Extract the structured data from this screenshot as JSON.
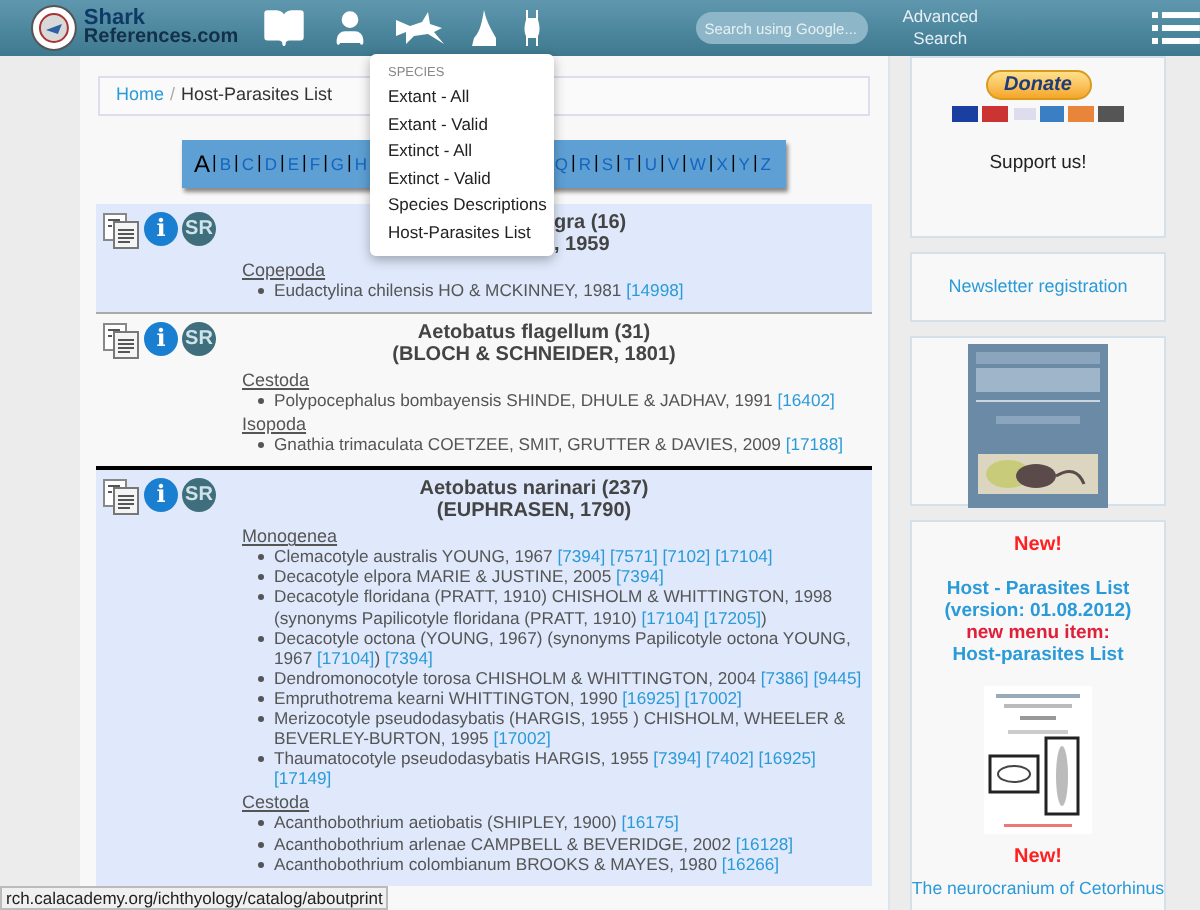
{
  "header": {
    "logo_top": "Shark",
    "logo_bottom": "References.com",
    "search": {
      "placeholder": "Search using Google..."
    },
    "advanced_search": "Advanced Search"
  },
  "menu": {
    "heading": "SPECIES",
    "items": [
      "Extant - All",
      "Extant - Valid",
      "Extinct - All",
      "Extinct - Valid",
      "Species Descriptions",
      "Host-Parasites List"
    ]
  },
  "breadcrumb": {
    "separator": "/",
    "items": [
      {
        "label": "Home",
        "kind": "link"
      },
      {
        "label": "Host-Parasites List",
        "kind": "current"
      }
    ]
  },
  "alphabet": {
    "separator": "|",
    "before": [
      {
        "letter": "A",
        "selected": true
      },
      {
        "letter": "B",
        "selected": false
      },
      {
        "letter": "C",
        "selected": false
      },
      {
        "letter": "D",
        "selected": false
      },
      {
        "letter": "E",
        "selected": false
      },
      {
        "letter": "F",
        "selected": false
      },
      {
        "letter": "G",
        "selected": false
      },
      {
        "letter": "H",
        "selected": false
      }
    ],
    "after": [
      {
        "letter": "Q",
        "selected": false
      },
      {
        "letter": "R",
        "selected": false
      },
      {
        "letter": "S",
        "selected": false
      },
      {
        "letter": "T",
        "selected": false
      },
      {
        "letter": "U",
        "selected": false
      },
      {
        "letter": "V",
        "selected": false
      },
      {
        "letter": "W",
        "selected": false
      },
      {
        "letter": "X",
        "selected": false
      },
      {
        "letter": "Y",
        "selected": false
      },
      {
        "letter": "Z",
        "selected": false
      }
    ]
  },
  "entries": [
    {
      "host": "gra (16)",
      "authority": ", 1959",
      "highlighted": true,
      "covered_by_menu": true,
      "info_label": "i",
      "sr_label": "SR",
      "groups": [
        {
          "name": "Copepoda",
          "parasites": [
            [
              {
                "kind": "text",
                "text": "Eudactylina chilensis HO & MCKINNEY, 1981"
              },
              {
                "kind": "ref",
                "text": "[14998]"
              }
            ]
          ]
        }
      ]
    },
    {
      "host": "Aetobatus flagellum (31)",
      "authority": "(BLOCH & SCHNEIDER, 1801)",
      "highlighted": false,
      "covered_by_menu": false,
      "info_label": "i",
      "sr_label": "SR",
      "groups": [
        {
          "name": "Cestoda",
          "parasites": [
            [
              {
                "kind": "text",
                "text": "Polypocephalus bombayensis SHINDE, DHULE & JADHAV, 1991"
              },
              {
                "kind": "ref",
                "text": "[16402]"
              }
            ]
          ]
        },
        {
          "name": "Isopoda",
          "parasites": [
            [
              {
                "kind": "text",
                "text": "Gnathia trimaculata COETZEE, SMIT, GRUTTER & DAVIES, 2009"
              },
              {
                "kind": "ref",
                "text": "[17188]"
              }
            ]
          ]
        }
      ]
    },
    {
      "host": "Aetobatus narinari (237)",
      "authority": "(EUPHRASEN, 1790)",
      "highlighted": true,
      "covered_by_menu": false,
      "info_label": "i",
      "sr_label": "SR",
      "groups": [
        {
          "name": "Monogenea",
          "parasites": [
            [
              {
                "kind": "text",
                "text": "Clemacotyle australis YOUNG, 1967"
              },
              {
                "kind": "ref",
                "text": "[7394]"
              },
              {
                "kind": "ref",
                "text": "[7571]"
              },
              {
                "kind": "ref",
                "text": "[7102]"
              },
              {
                "kind": "ref",
                "text": "[17104]"
              }
            ],
            [
              {
                "kind": "text",
                "text": "Decacotyle elpora MARIE & JUSTINE, 2005"
              },
              {
                "kind": "ref",
                "text": "[7394]"
              }
            ],
            [
              {
                "kind": "text",
                "text": "Decacotyle floridana (PRATT, 1910) CHISHOLM & WHITTINGTON, 1998 (synonyms Papilicotyle floridana (PRATT, 1910)"
              },
              {
                "kind": "ref",
                "text": "[17104]"
              },
              {
                "kind": "ref",
                "text": "[17205]"
              },
              {
                "kind": "text",
                "text": ")"
              }
            ],
            [
              {
                "kind": "text",
                "text": "Decacotyle octona (YOUNG, 1967) (synonyms Papilicotyle octona YOUNG, 1967"
              },
              {
                "kind": "ref",
                "text": "[17104]"
              },
              {
                "kind": "text",
                "text": ")"
              },
              {
                "kind": "ref",
                "text": "[7394]"
              }
            ],
            [
              {
                "kind": "text",
                "text": "Dendromonocotyle torosa CHISHOLM & WHITTINGTON, 2004"
              },
              {
                "kind": "ref",
                "text": "[7386]"
              },
              {
                "kind": "ref",
                "text": "[9445]"
              }
            ],
            [
              {
                "kind": "text",
                "text": "Empruthotrema kearni WHITTINGTON, 1990"
              },
              {
                "kind": "ref",
                "text": "[16925]"
              },
              {
                "kind": "ref",
                "text": "[17002]"
              }
            ],
            [
              {
                "kind": "text",
                "text": "Merizocotyle pseudodasybatis (HARGIS, 1955 ) CHISHOLM, WHEELER & BEVERLEY-BURTON, 1995"
              },
              {
                "kind": "ref",
                "text": "[17002]"
              }
            ],
            [
              {
                "kind": "text",
                "text": "Thaumatocotyle pseudodasybatis HARGIS, 1955"
              },
              {
                "kind": "ref",
                "text": "[7394]"
              },
              {
                "kind": "ref",
                "text": "[7402]"
              },
              {
                "kind": "ref",
                "text": "[16925]"
              },
              {
                "kind": "ref",
                "text": "[17149]"
              }
            ]
          ]
        },
        {
          "name": "Cestoda",
          "parasites": [
            [
              {
                "kind": "text",
                "text": "Acanthobothrium aetiobatis (SHIPLEY, 1900)"
              },
              {
                "kind": "ref",
                "text": "[16175]"
              }
            ],
            [
              {
                "kind": "text",
                "text": "Acanthobothrium arlenae CAMPBELL & BEVERIDGE, 2002"
              },
              {
                "kind": "ref",
                "text": "[16128]"
              }
            ],
            [
              {
                "kind": "text",
                "text": "Acanthobothrium colombianum BROOKS & MAYES, 1980"
              },
              {
                "kind": "ref",
                "text": "[16266]"
              }
            ]
          ]
        }
      ]
    }
  ],
  "sidebar": {
    "donate": "Donate",
    "support": "Support us!",
    "newsletter": "Newsletter registration",
    "news": [
      {
        "kind": "badge",
        "text": "New!"
      },
      {
        "kind": "link",
        "text": "Host - Parasites List (version: 01.08.2012)"
      },
      {
        "kind": "mixed",
        "label": "new menu item:",
        "link": "Host-parasites List"
      },
      {
        "kind": "picture"
      },
      {
        "kind": "badge",
        "text": "New!"
      },
      {
        "kind": "article",
        "text": "The neurocranium of Cetorhinus"
      }
    ]
  },
  "status_bar": "rch.calacademy.org/ichthyology/catalog/aboutprint"
}
